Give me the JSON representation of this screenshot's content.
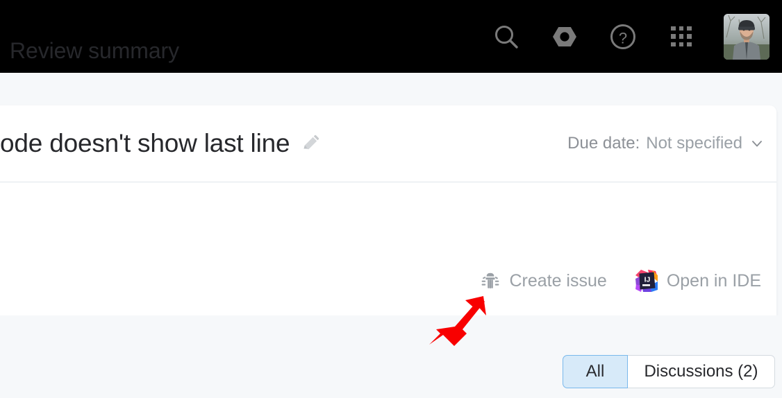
{
  "topbar": {
    "background": "#000000",
    "icon_color": "#7a7a7a",
    "icons": [
      {
        "name": "search-icon",
        "label": "Search"
      },
      {
        "name": "settings-gear-icon",
        "label": "Settings"
      },
      {
        "name": "help-question-icon",
        "label": "Help"
      },
      {
        "name": "apps-grid-icon",
        "label": "Apps"
      }
    ],
    "avatar": {
      "name": "user-avatar",
      "label": "User profile photo"
    }
  },
  "issue": {
    "title": "ode doesn't show last line",
    "title_truncated_left": true,
    "edit_icon": "pencil-icon",
    "due_date_label": "Due date:",
    "due_date_value": "Not specified",
    "due_date_chevron": "chevron-down-icon"
  },
  "actions": [
    {
      "name": "create-issue-button",
      "icon": "bug-icon",
      "label": "Create issue"
    },
    {
      "name": "open-in-ide-button",
      "icon": "intellij-ij-icon",
      "label": "Open in IDE"
    }
  ],
  "annotation": {
    "name": "red-arrow-annotation",
    "color": "#f80000",
    "points_to": "create-issue-button"
  },
  "summary": {
    "heading": "Review summary",
    "filters": [
      {
        "name": "filter-tab-all",
        "label": "All",
        "selected": true
      },
      {
        "name": "filter-tab-discussions",
        "label": "Discussions (2)",
        "selected": false
      }
    ]
  },
  "colors": {
    "page_background": "#f6f8fa",
    "card_background": "#ffffff",
    "divider": "#dfe5eb",
    "text_primary": "#27282c",
    "text_muted": "#9aa0a6",
    "selected_fill": "#d7eaf9",
    "selected_border": "#79b8ec",
    "accent_red": "#f80000"
  }
}
